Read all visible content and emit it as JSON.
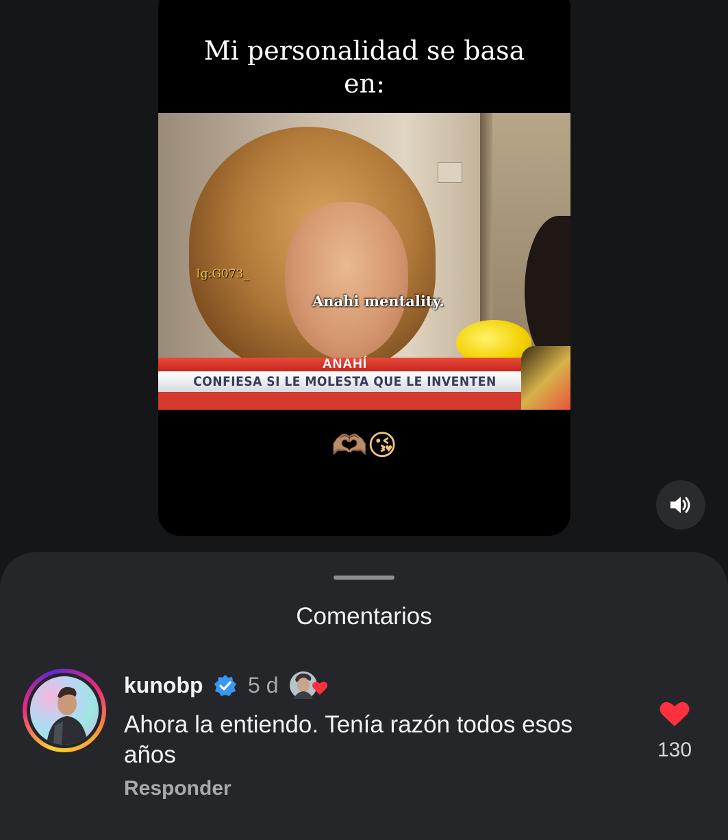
{
  "reel": {
    "caption": "Mi personalidad se basa en:",
    "watermark": "Ig:G073_",
    "subtitle": "Anahi mentality.",
    "lower_third_name": "ANAHÍ",
    "lower_third_headline": "CONFIESA SI LE MOLESTA QUE LE INVENTEN",
    "emojis": "🫶🏽😘"
  },
  "sound_button": {
    "icon": "speaker-icon"
  },
  "comments": {
    "title": "Comentarios",
    "items": [
      {
        "username": "kunobp",
        "verified": true,
        "time": "5 d",
        "text": "Ahora la entiendo. Tenía razón todos esos años",
        "reply_label": "Responder",
        "likes": "130",
        "liked_by_creator": true,
        "liked": true
      }
    ]
  },
  "colors": {
    "background": "#151617",
    "sheet": "#25262a",
    "like_red": "#ff3040",
    "verified_blue": "#3897f0"
  }
}
